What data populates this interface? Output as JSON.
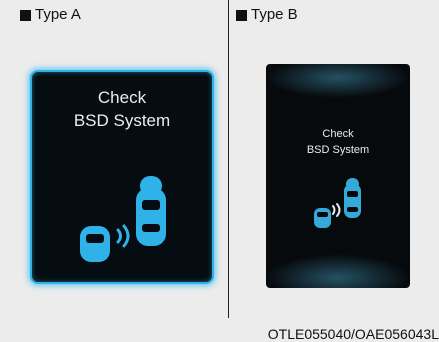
{
  "panels": [
    {
      "label": "Type A",
      "message": [
        "Check",
        "BSD System"
      ]
    },
    {
      "label": "Type B",
      "message": [
        "Check",
        "BSD System"
      ]
    }
  ],
  "caption": "OTLE055040/OAE056043L",
  "colors": {
    "accent": "#2fb2e8",
    "screen": "#050d12",
    "text": "#e8eef2"
  }
}
